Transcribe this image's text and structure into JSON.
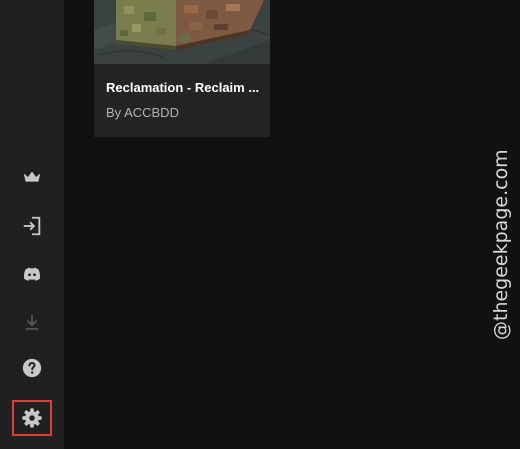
{
  "card": {
    "title": "Reclamation - Reclaim ...",
    "author": "By ACCBDD"
  },
  "sidebar": {
    "items": [
      {
        "name": "crown-icon",
        "interactable": true
      },
      {
        "name": "login-icon",
        "interactable": true
      },
      {
        "name": "discord-icon",
        "interactable": true
      },
      {
        "name": "download-icon",
        "interactable": true,
        "disabled": true
      },
      {
        "name": "help-icon",
        "interactable": true
      },
      {
        "name": "settings-icon",
        "interactable": true,
        "selected": true
      }
    ]
  },
  "watermark": "@thegeekpage.com",
  "colors": {
    "background": "#111111",
    "sidebar": "#202020",
    "card": "#242424",
    "highlight": "#e03a3a"
  }
}
